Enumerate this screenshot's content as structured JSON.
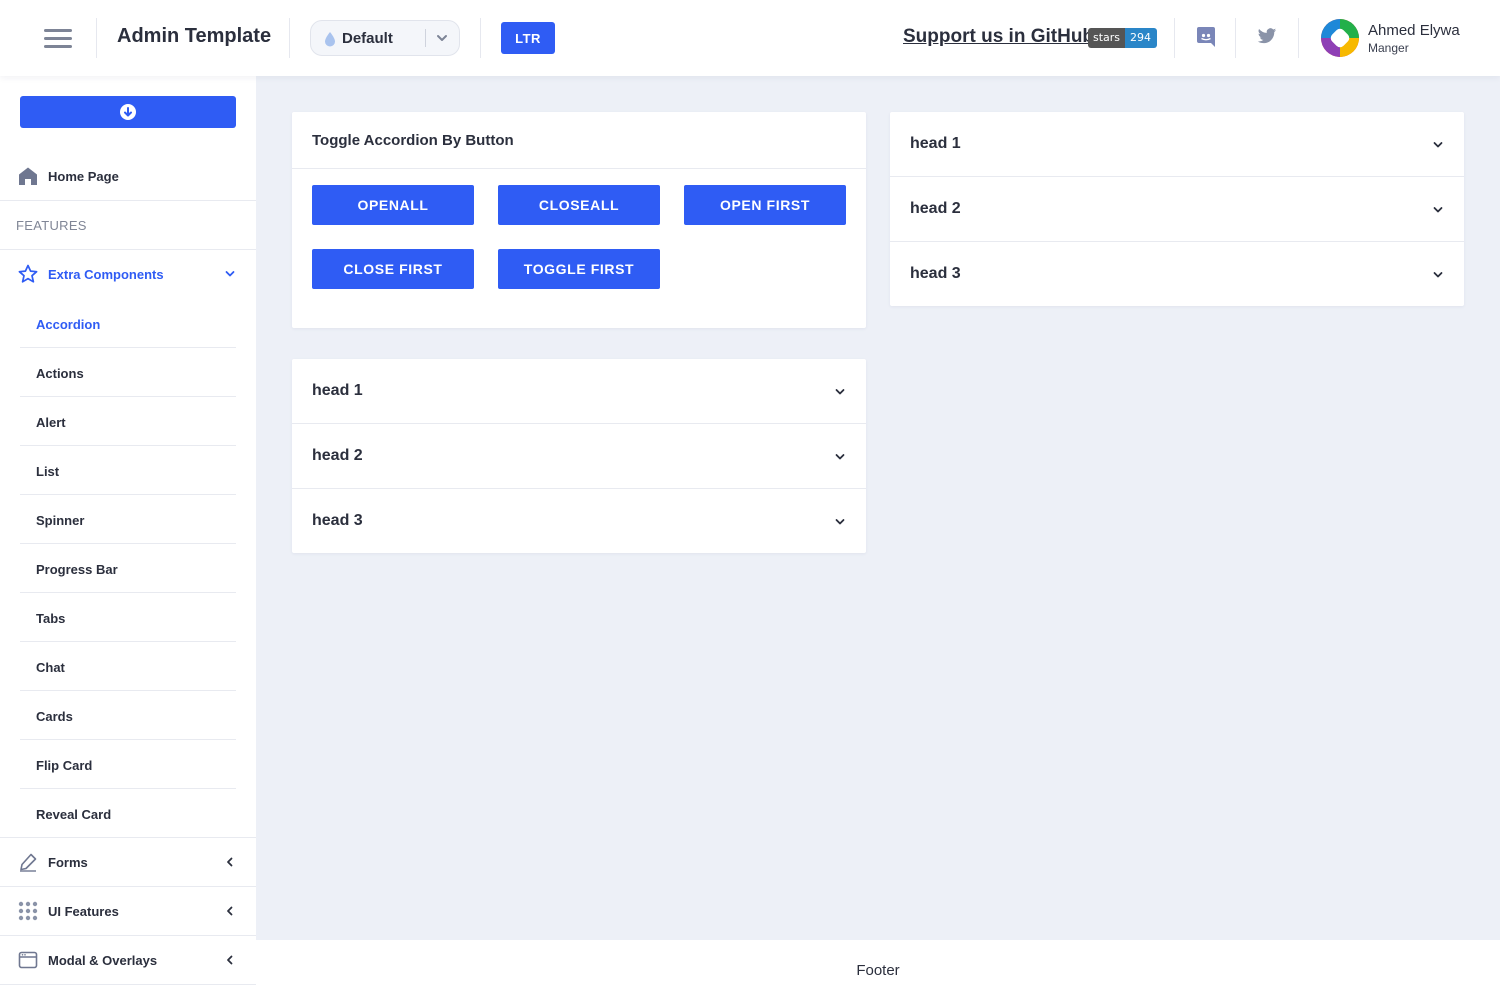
{
  "header": {
    "title": "Admin Template",
    "theme": {
      "label": "Default"
    },
    "direction_label": "LTR",
    "support_link": "Support us in GitHub",
    "stars_badge": {
      "key": "stars",
      "value": "294"
    },
    "user": {
      "name": "Ahmed Elywa",
      "role": "Manger"
    }
  },
  "sidebar": {
    "home": "Home Page",
    "section_label": "FEATURES",
    "extra_components": {
      "label": "Extra Components",
      "items": [
        "Accordion",
        "Actions",
        "Alert",
        "List",
        "Spinner",
        "Progress Bar",
        "Tabs",
        "Chat",
        "Cards",
        "Flip Card",
        "Reveal Card"
      ],
      "active": "Accordion"
    },
    "forms": "Forms",
    "ui_features": "UI Features",
    "modal_overlays": "Modal & Overlays"
  },
  "toggle_card": {
    "title": "Toggle Accordion By Button",
    "buttons": [
      "OPENALL",
      "CLOSEALL",
      "OPEN FIRST",
      "CLOSE FIRST",
      "TOGGLE FIRST"
    ]
  },
  "accordion_left": {
    "heads": [
      "head 1",
      "head 2",
      "head 3"
    ]
  },
  "accordion_right": {
    "heads": [
      "head 1",
      "head 2",
      "head 3"
    ]
  },
  "footer": {
    "text": "Footer"
  },
  "colors": {
    "primary": "#2f5cf4",
    "background": "#edf0f7",
    "text": "#2b2f3d",
    "muted": "#808696"
  }
}
